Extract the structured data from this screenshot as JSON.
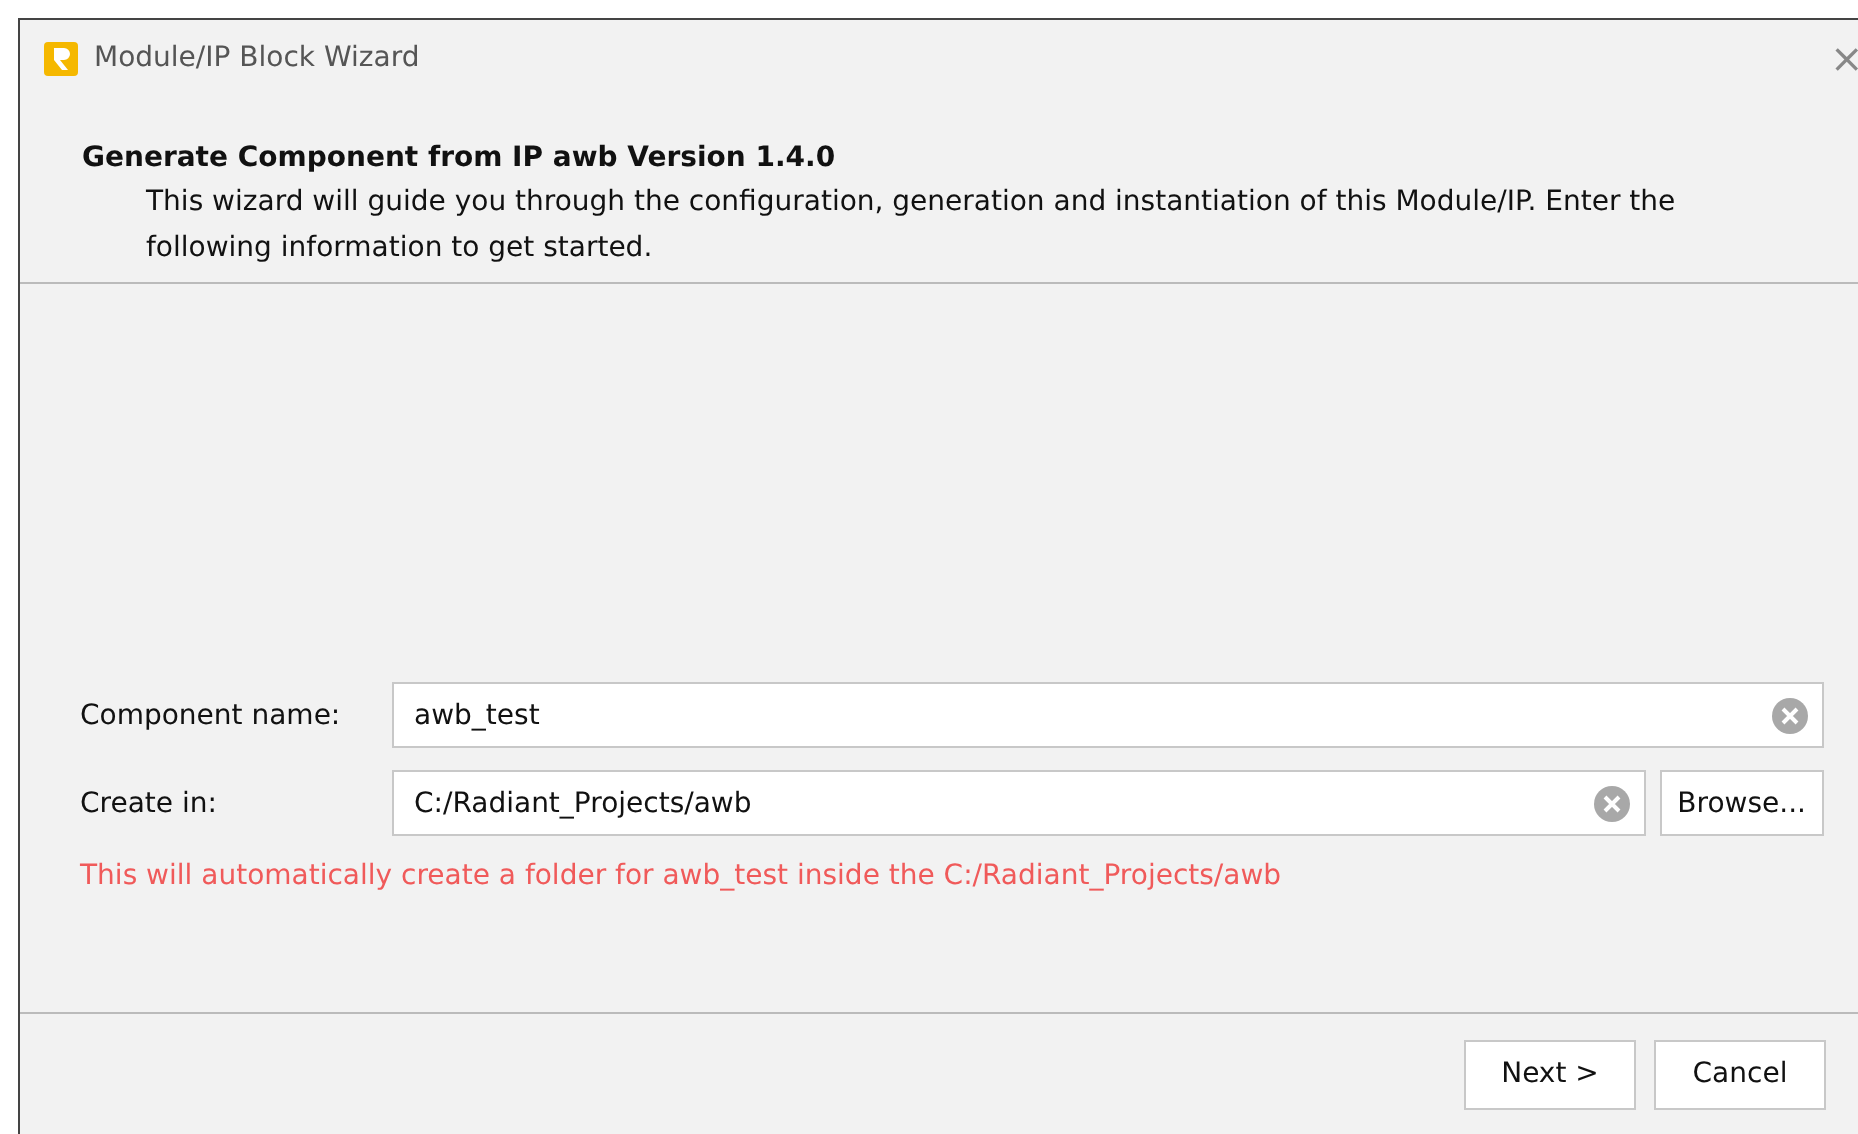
{
  "window": {
    "title": "Module/IP Block Wizard",
    "close": "×"
  },
  "header": {
    "title": "Generate Component from IP awb Version 1.4.0",
    "description": "This wizard will guide you through the configuration, generation and instantiation of this Module/IP. Enter the following information to get started."
  },
  "fields": [
    {
      "label": "Component name:",
      "value": "awb_test",
      "browse": false
    },
    {
      "label": "Create in:",
      "value": "C:/Radiant_Projects/awb",
      "browse": true
    }
  ],
  "browse_button": "Browse...",
  "message": "This will automatically create a folder for awb_test inside the C:/Radiant_Projects/awb",
  "buttons": [
    "Next >",
    "Cancel"
  ]
}
